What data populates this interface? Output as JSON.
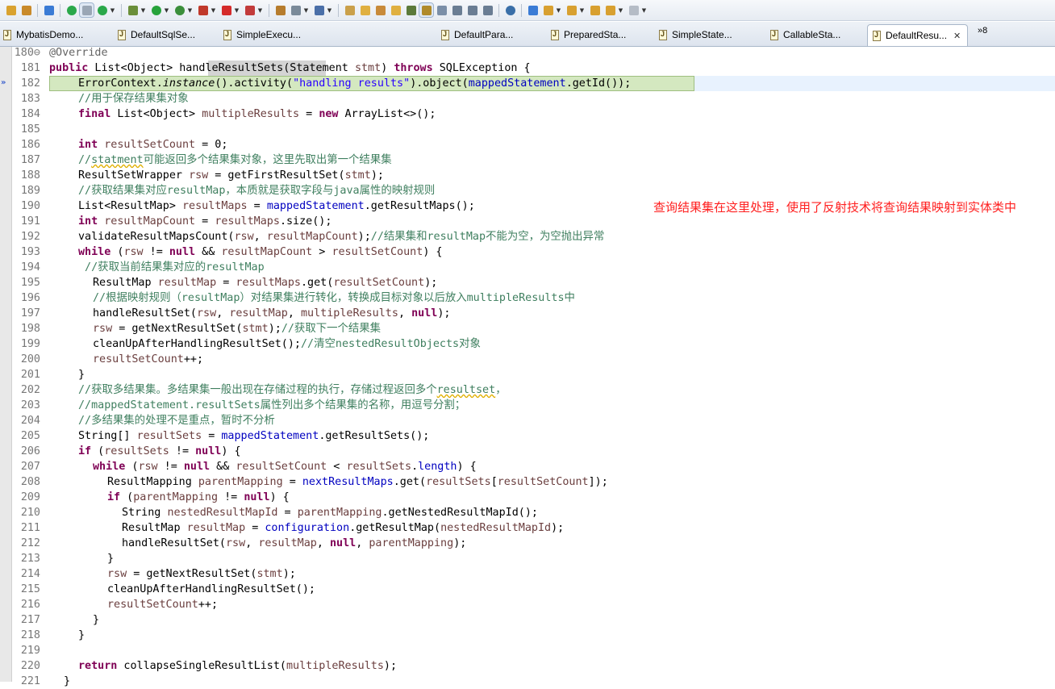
{
  "toolbar": {
    "icons": [
      "new-icon",
      "open-type-icon",
      "build-icon",
      "debug-icon",
      "layout-icon",
      "refresh-icon",
      "bug-icon",
      "run-icon",
      "run-external-icon",
      "coverage-icon",
      "stop-icon",
      "deploy-icon",
      "format-icon",
      "server-icon",
      "gear-icon",
      "package-icon",
      "folder-open-icon",
      "pen-icon",
      "folder-icon",
      "task-icon",
      "toggle-mark-icon",
      "link-icon",
      "doc-icon",
      "block-icon",
      "paragraph-icon",
      "globe-icon",
      "search-icon",
      "next-annotation-icon",
      "prev-annotation-icon",
      "last-edit-icon",
      "back-icon",
      "forward-icon"
    ]
  },
  "tabs": [
    {
      "label": "MybatisDemo..."
    },
    {
      "label": "DefaultSqlSe..."
    },
    {
      "label": "SimpleExecu..."
    },
    {
      "label": "DefaultPara..."
    },
    {
      "label": "PreparedSta..."
    },
    {
      "label": "SimpleState..."
    },
    {
      "label": "CallableSta..."
    },
    {
      "label": "DefaultResu..."
    }
  ],
  "overflow": {
    "label": "»8"
  },
  "annotation": "查询结果集在这里处理，使用了反射技术将查询结果映射到实体类中",
  "line_numbers": [
    "180⊖",
    "181",
    "182",
    "183",
    "184",
    "185",
    "186",
    "187",
    "188",
    "189",
    "190",
    "191",
    "192",
    "193",
    "194",
    "195",
    "196",
    "197",
    "198",
    "199",
    "200",
    "201",
    "202",
    "203",
    "204",
    "205",
    "206",
    "207",
    "208",
    "209",
    "210",
    "211",
    "212",
    "213",
    "214",
    "215",
    "216",
    "217",
    "218",
    "219",
    "220",
    "221"
  ],
  "code": {
    "l180": "@Override",
    "l181_kw": "public",
    "l181_a": " List<Object> ",
    "l181_m": "handleResultSets",
    "l181_b": "(Statement ",
    "l181_p": "stmt",
    "l181_c": ") ",
    "l181_kw2": "throws",
    "l181_d": " SQLException {",
    "l182_a": "ErrorContext.",
    "l182_it": "instance",
    "l182_b": "().activity(",
    "l182_st": "\"handling results\"",
    "l182_c": ").object(",
    "l182_fd": "mappedStatement",
    "l182_d": ".getId());",
    "l183": "//用于保存结果集对象",
    "l184_kw": "final",
    "l184_a": " List<Object> ",
    "l184_lv": "multipleResults",
    "l184_b": " = ",
    "l184_kw2": "new",
    "l184_c": " ArrayList<>();",
    "l186_kw": "int",
    "l186_lv": " resultSetCount",
    "l186_a": " = 0;",
    "l187_a": "//",
    "l187_sq": "statment",
    "l187_b": "可能返回多个结果集对象，这里先取出第一个结果集",
    "l188_a": "ResultSetWrapper ",
    "l188_lv": "rsw",
    "l188_b": " = getFirstResultSet(",
    "l188_lv2": "stmt",
    "l188_c": ");",
    "l189": "//获取结果集对应resultMap，本质就是获取字段与java属性的映射规则",
    "l190_a": "List<ResultMap> ",
    "l190_lv": "resultMaps",
    "l190_b": " = ",
    "l190_fd": "mappedStatement",
    "l190_c": ".getResultMaps();",
    "l191_kw": "int",
    "l191_lv": " resultMapCount",
    "l191_a": " = ",
    "l191_lv2": "resultMaps",
    "l191_b": ".size();",
    "l192_a": "validateResultMapsCount(",
    "l192_lv": "rsw",
    "l192_b": ", ",
    "l192_lv2": "resultMapCount",
    "l192_c": ");",
    "l192_cm": "//结果集和resultMap不能为空，为空抛出异常",
    "l193_kw": "while",
    "l193_a": " (",
    "l193_lv": "rsw",
    "l193_b": " != ",
    "l193_kw2": "null",
    "l193_c": " && ",
    "l193_lv2": "resultMapCount",
    "l193_d": " > ",
    "l193_lv3": "resultSetCount",
    "l193_e": ") {",
    "l194": " //获取当前结果集对应的resultMap",
    "l195_a": "ResultMap ",
    "l195_lv": "resultMap",
    "l195_b": " = ",
    "l195_lv2": "resultMaps",
    "l195_c": ".get(",
    "l195_lv3": "resultSetCount",
    "l195_d": ");",
    "l196": "//根据映射规则（resultMap）对结果集进行转化，转换成目标对象以后放入multipleResults中",
    "l197_a": "handleResultSet(",
    "l197_lv": "rsw",
    "l197_b": ", ",
    "l197_lv2": "resultMap",
    "l197_c": ", ",
    "l197_lv3": "multipleResults",
    "l197_d": ", ",
    "l197_kw": "null",
    "l197_e": ");",
    "l198_lv": "rsw",
    "l198_a": " = getNextResultSet(",
    "l198_lv2": "stmt",
    "l198_b": ");",
    "l198_cm": "//获取下一个结果集",
    "l199_a": "cleanUpAfterHandlingResultSet();",
    "l199_cm": "//清空nestedResultObjects对象",
    "l200_lv": "resultSetCount",
    "l200_a": "++;",
    "l201": "}",
    "l202_a": "//获取多结果集。多结果集一般出现在存储过程的执行，存储过程返回多个",
    "l202_sq": "resultset",
    "l202_b": "，",
    "l203": "//mappedStatement.resultSets属性列出多个结果集的名称，用逗号分割；",
    "l204": "//多结果集的处理不是重点，暂时不分析",
    "l205_a": "String[] ",
    "l205_lv": "resultSets",
    "l205_b": " = ",
    "l205_fd": "mappedStatement",
    "l205_c": ".getResultSets();",
    "l206_kw": "if",
    "l206_a": " (",
    "l206_lv": "resultSets",
    "l206_b": " != ",
    "l206_kw2": "null",
    "l206_c": ") {",
    "l207_kw": "while",
    "l207_a": " (",
    "l207_lv": "rsw",
    "l207_b": " != ",
    "l207_kw2": "null",
    "l207_c": " && ",
    "l207_lv2": "resultSetCount",
    "l207_d": " < ",
    "l207_lv3": "resultSets",
    "l207_e": ".",
    "l207_fd": "length",
    "l207_f": ") {",
    "l208_a": "ResultMapping ",
    "l208_lv": "parentMapping",
    "l208_b": " = ",
    "l208_fd": "nextResultMaps",
    "l208_c": ".get(",
    "l208_lv2": "resultSets",
    "l208_d": "[",
    "l208_lv3": "resultSetCount",
    "l208_e": "]);",
    "l209_kw": "if",
    "l209_a": " (",
    "l209_lv": "parentMapping",
    "l209_b": " != ",
    "l209_kw2": "null",
    "l209_c": ") {",
    "l210_a": "String ",
    "l210_lv": "nestedResultMapId",
    "l210_b": " = ",
    "l210_lv2": "parentMapping",
    "l210_c": ".getNestedResultMapId();",
    "l211_a": "ResultMap ",
    "l211_lv": "resultMap",
    "l211_b": " = ",
    "l211_fd": "configuration",
    "l211_c": ".getResultMap(",
    "l211_lv2": "nestedResultMapId",
    "l211_d": ");",
    "l212_a": "handleResultSet(",
    "l212_lv": "rsw",
    "l212_b": ", ",
    "l212_lv2": "resultMap",
    "l212_c": ", ",
    "l212_kw": "null",
    "l212_d": ", ",
    "l212_lv3": "parentMapping",
    "l212_e": ");",
    "l213": "}",
    "l214_lv": "rsw",
    "l214_a": " = getNextResultSet(",
    "l214_lv2": "stmt",
    "l214_b": ");",
    "l215": "cleanUpAfterHandlingResultSet();",
    "l216_lv": "resultSetCount",
    "l216_a": "++;",
    "l217": "}",
    "l218": "}",
    "l220_kw": "return",
    "l220_a": " collapseSingleResultList(",
    "l220_lv": "multipleResults",
    "l220_b": ");",
    "l221": "}"
  }
}
